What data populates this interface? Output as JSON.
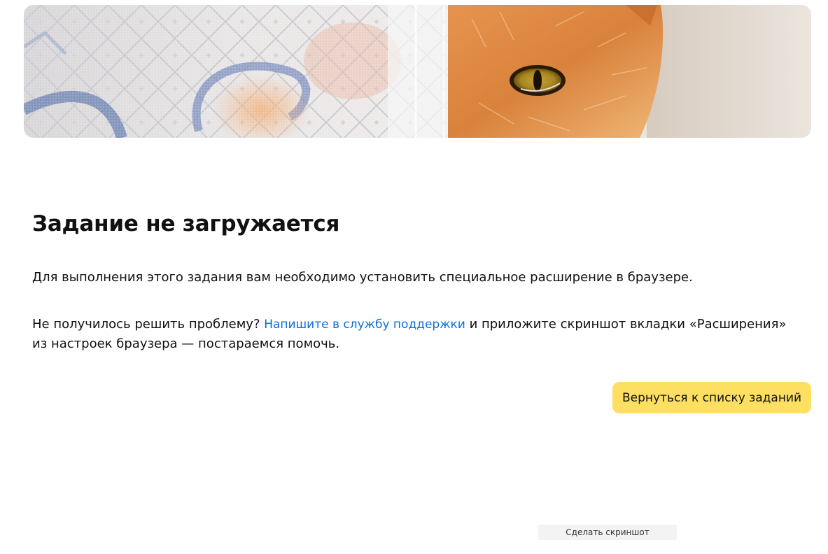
{
  "banner": {
    "image": "cat-behind-curtain-photo"
  },
  "main": {
    "title": "Задание не загружается",
    "description": "Для выполнения этого задания вам необходимо установить специальное расширение в браузере.",
    "help": {
      "before_link": "Не получилось решить проблему? ",
      "link_label": "Напишите в службу поддержки",
      "after_link": " и приложите скриншот вкладки «Расширения»",
      "second_line": "из настроек браузера — постараемся помочь."
    },
    "back_button_label": "Вернуться к списку заданий"
  },
  "screenshot_button_label": "Сделать скриншот",
  "colors": {
    "accent_button": "#fddf61",
    "link": "#0a6fde",
    "text": "#111111"
  }
}
